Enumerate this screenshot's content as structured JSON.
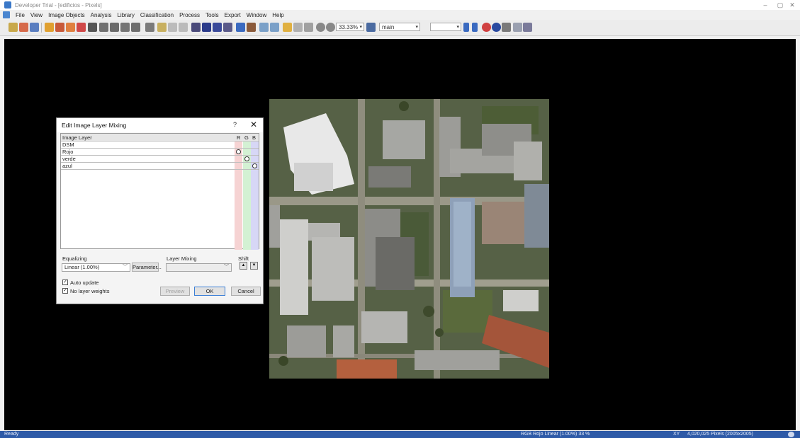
{
  "window": {
    "title": "Developer Trial - [edificios - Pixels]",
    "minimize": "–",
    "maximize": "▢",
    "close": "✕"
  },
  "menu": [
    "File",
    "View",
    "Image Objects",
    "Analysis",
    "Library",
    "Classification",
    "Process",
    "Tools",
    "Export",
    "Window",
    "Help"
  ],
  "toolbar": {
    "zoom_value": "33.33%",
    "view_select": "main",
    "blank_select": "",
    "icons": [
      "open-project-icon",
      "save-icon",
      "workspace-icon",
      "layer-icon",
      "mixing-icon",
      "cursor-icon",
      "zoom-in-icon",
      "zoom-out-icon",
      "pan-icon",
      "help-icon",
      "settings-icon"
    ]
  },
  "dialog": {
    "title": "Edit Image Layer Mixing",
    "help": "?",
    "close": "✕",
    "columns": {
      "layer": "Image Layer",
      "r": "R",
      "g": "G",
      "b": "B"
    },
    "rows": [
      {
        "name": "DSM",
        "r": false,
        "g": false,
        "b": false
      },
      {
        "name": "Rojo",
        "r": true,
        "g": false,
        "b": false
      },
      {
        "name": "verde",
        "r": false,
        "g": true,
        "b": false
      },
      {
        "name": "azul",
        "r": false,
        "g": false,
        "b": true
      }
    ],
    "equalizing_label": "Equalizing",
    "equalizing_value": "Linear (1.00%)",
    "parameter_button": "Parameter...",
    "layer_mixing_label": "Layer Mixing",
    "layer_mixing_value": "",
    "shift_label": "Shift",
    "auto_update_label": "Auto update",
    "auto_update_checked": true,
    "no_weights_label": "No layer weights",
    "no_weights_checked": true,
    "preview_button": "Preview",
    "ok_button": "OK",
    "cancel_button": "Cancel",
    "colors": {
      "r": "#f6d3d3",
      "g": "#d3f1d3",
      "b": "#d7d7f6"
    }
  },
  "status": {
    "left": "Ready",
    "mixing": "RGB   Rojo   Linear (1.00%)   33 %",
    "coords": "XY",
    "pixels": "4,020,025 Pixels (2005x2005)"
  }
}
